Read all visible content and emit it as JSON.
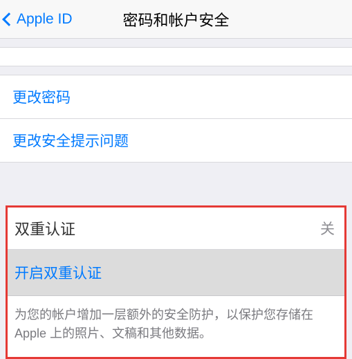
{
  "navbar": {
    "back_label": "Apple ID",
    "title": "密码和帐户安全"
  },
  "password_section": {
    "change_password": "更改密码",
    "change_security_questions": "更改安全提示问题"
  },
  "two_factor": {
    "header": "双重认证",
    "status": "关",
    "enable_label": "开启双重认证",
    "description": "为您的帐户增加一层额外的安全防护，以保护您存储在 Apple 上的照片、文稿和其他数据。"
  }
}
